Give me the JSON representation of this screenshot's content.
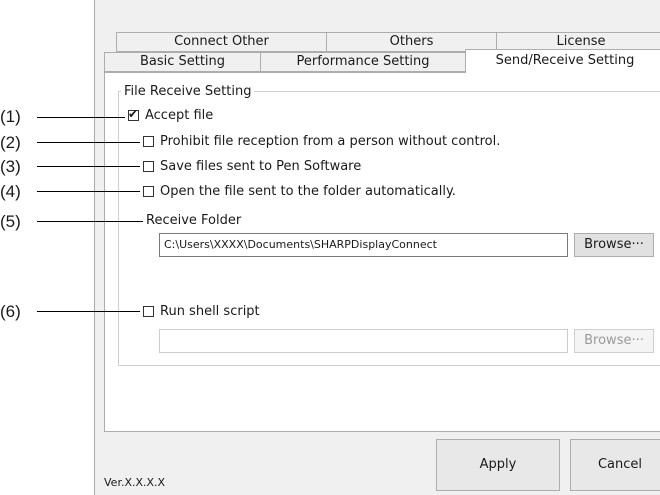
{
  "tabs_back": [
    "Connect Other",
    "Others",
    "License"
  ],
  "tabs_front": [
    "Basic Setting",
    "Performance Setting",
    "Send/Receive Setting"
  ],
  "group": {
    "title": "File Receive Setting"
  },
  "options": {
    "accept_file": {
      "label": "Accept file",
      "checked": true
    },
    "prohibit": {
      "label": "Prohibit file reception from a person without control.",
      "checked": false
    },
    "save_pen": {
      "label": "Save files sent to Pen Software",
      "checked": false
    },
    "open_folder": {
      "label": "Open the file sent to the folder automatically.",
      "checked": false
    },
    "run_shell": {
      "label": "Run shell script",
      "checked": false
    }
  },
  "receive_folder": {
    "label": "Receive Folder",
    "value": "C:\\Users\\XXXX\\Documents\\SHARPDisplayConnect"
  },
  "shell_script": {
    "value": ""
  },
  "browse_label": "Browse···",
  "buttons": {
    "apply": "Apply",
    "cancel": "Cancel"
  },
  "version": "Ver.X.X.X.X",
  "callouts": [
    "(1)",
    "(2)",
    "(3)",
    "(4)",
    "(5)",
    "(6)"
  ],
  "check_glyph": "✔"
}
